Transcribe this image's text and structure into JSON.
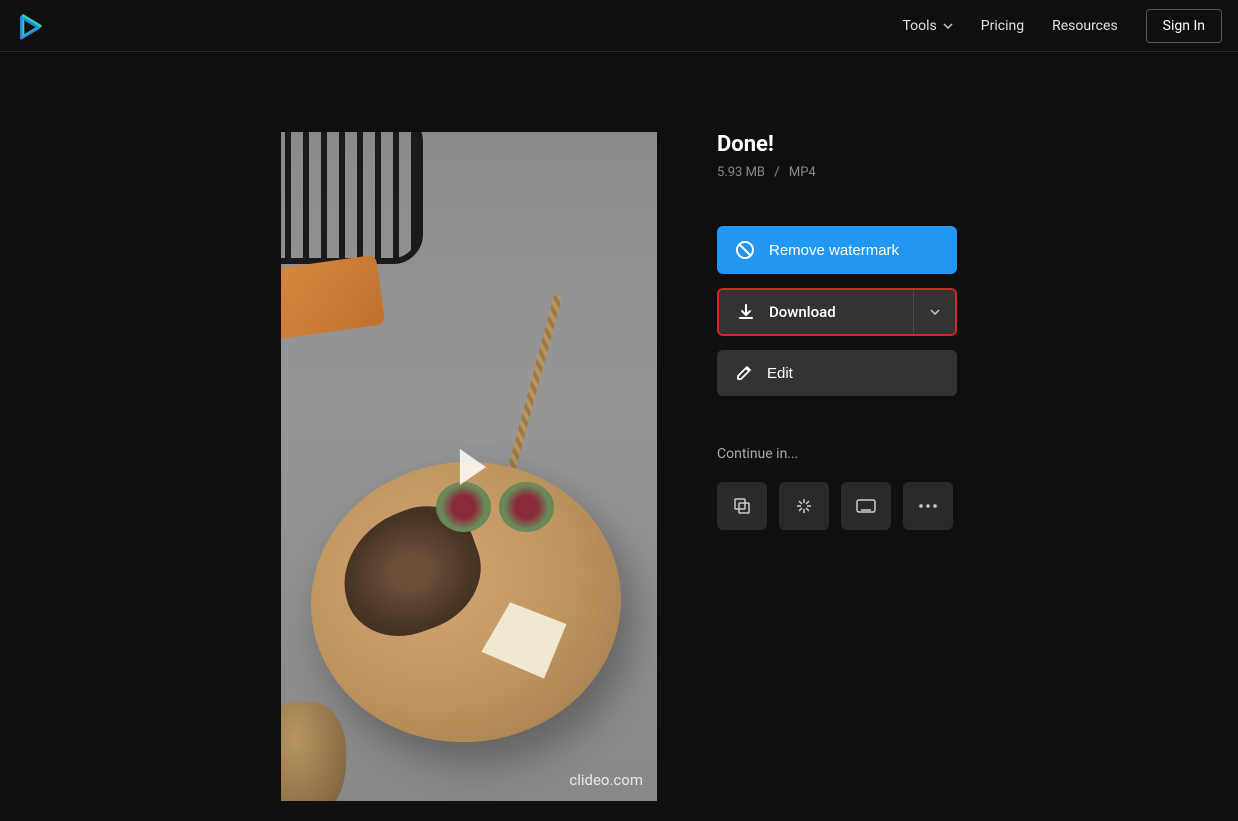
{
  "header": {
    "nav": {
      "tools": "Tools",
      "pricing": "Pricing",
      "resources": "Resources"
    },
    "sign_in": "Sign In"
  },
  "preview": {
    "watermark": "clideo.com"
  },
  "result": {
    "title": "Done!",
    "file_size": "5.93 MB",
    "file_format": "MP4"
  },
  "buttons": {
    "remove_watermark": "Remove watermark",
    "download": "Download",
    "edit": "Edit"
  },
  "continue": {
    "label": "Continue in..."
  }
}
